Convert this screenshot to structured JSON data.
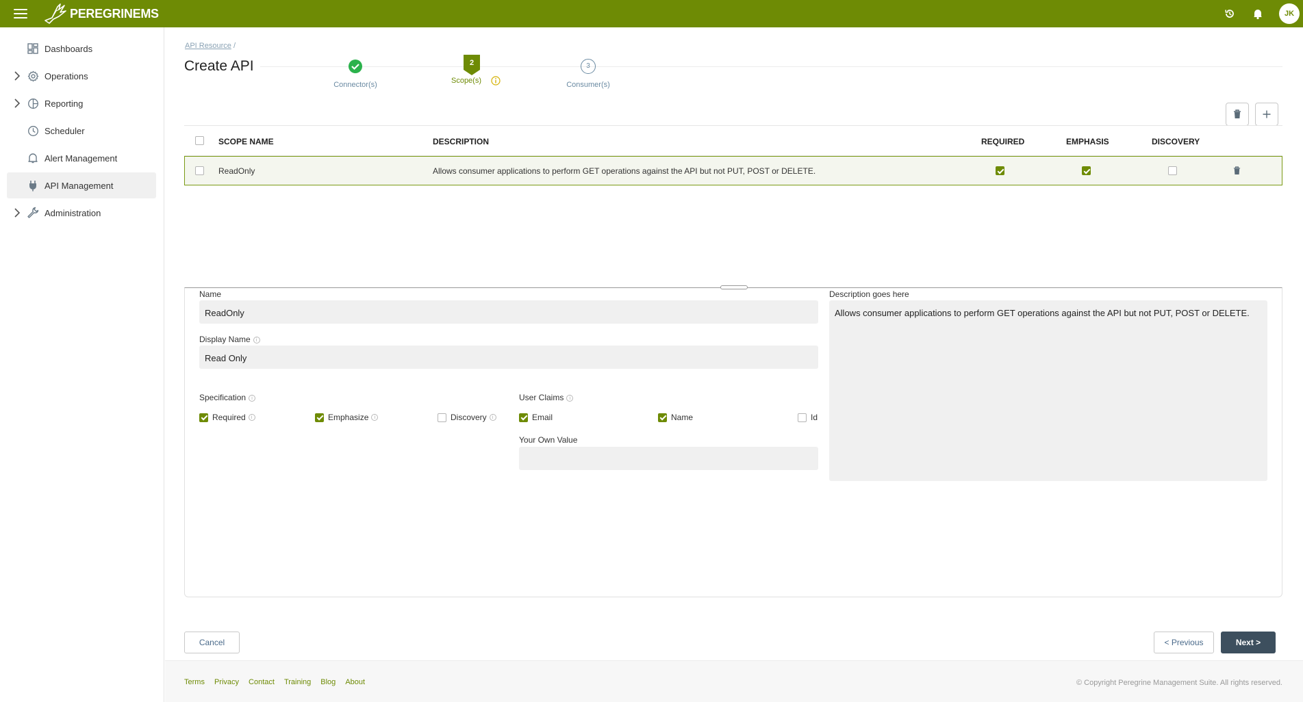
{
  "app": {
    "brand": "PEREGRINEMS",
    "user_initials": "JK",
    "accent_color": "#6e8b05"
  },
  "sidebar": {
    "items": [
      {
        "label": "Dashboards",
        "icon": "dashboard-icon",
        "expandable": false
      },
      {
        "label": "Operations",
        "icon": "gear-icon",
        "expandable": true
      },
      {
        "label": "Reporting",
        "icon": "pie-chart-icon",
        "expandable": true
      },
      {
        "label": "Scheduler",
        "icon": "clock-icon",
        "expandable": false
      },
      {
        "label": "Alert Management",
        "icon": "bell-icon",
        "expandable": false
      },
      {
        "label": "API Management",
        "icon": "plug-icon",
        "expandable": false,
        "active": true
      },
      {
        "label": "Administration",
        "icon": "wrench-icon",
        "expandable": true
      }
    ]
  },
  "breadcrumb": {
    "link": "API Resource",
    "separator": "/"
  },
  "page": {
    "title": "Create API"
  },
  "stepper": {
    "steps": [
      {
        "label": "Connector(s)",
        "state": "complete"
      },
      {
        "label": "Scope(s)",
        "number": "2",
        "state": "active"
      },
      {
        "label": "Consumer(s)",
        "number": "3",
        "state": "pending"
      }
    ]
  },
  "table": {
    "headers": [
      "SCOPE NAME",
      "DESCRIPTION",
      "REQUIRED",
      "EMPHASIS",
      "DISCOVERY"
    ],
    "rows": [
      {
        "scope_name": "ReadOnly",
        "description": "Allows consumer applications to perform GET operations against the API but not PUT, POST or DELETE.",
        "required": true,
        "emphasis": true,
        "discovery": false
      }
    ]
  },
  "form": {
    "name_label": "Name",
    "name_value": "ReadOnly",
    "display_name_label": "Display Name",
    "display_name_value": "Read Only",
    "description_label": "Description goes here",
    "description_value": "Allows consumer applications to perform GET operations against the API but not PUT, POST or DELETE.",
    "specification_label": "Specification",
    "spec_options": [
      {
        "label": "Required",
        "checked": true
      },
      {
        "label": "Emphasize",
        "checked": true
      },
      {
        "label": "Discovery",
        "checked": false
      }
    ],
    "user_claims_label": "User Claims",
    "claims_options": [
      {
        "label": "Email",
        "checked": true
      },
      {
        "label": "Name",
        "checked": true
      },
      {
        "label": "Id",
        "checked": false
      }
    ],
    "own_value_label": "Your Own Value",
    "own_value": ""
  },
  "actions": {
    "cancel": "Cancel",
    "previous": "< Previous",
    "next": "Next >"
  },
  "footer": {
    "links": [
      "Terms",
      "Privacy",
      "Contact",
      "Training",
      "Blog",
      "About"
    ],
    "copyright": "© Copyright Peregrine Management Suite. All rights reserved."
  }
}
